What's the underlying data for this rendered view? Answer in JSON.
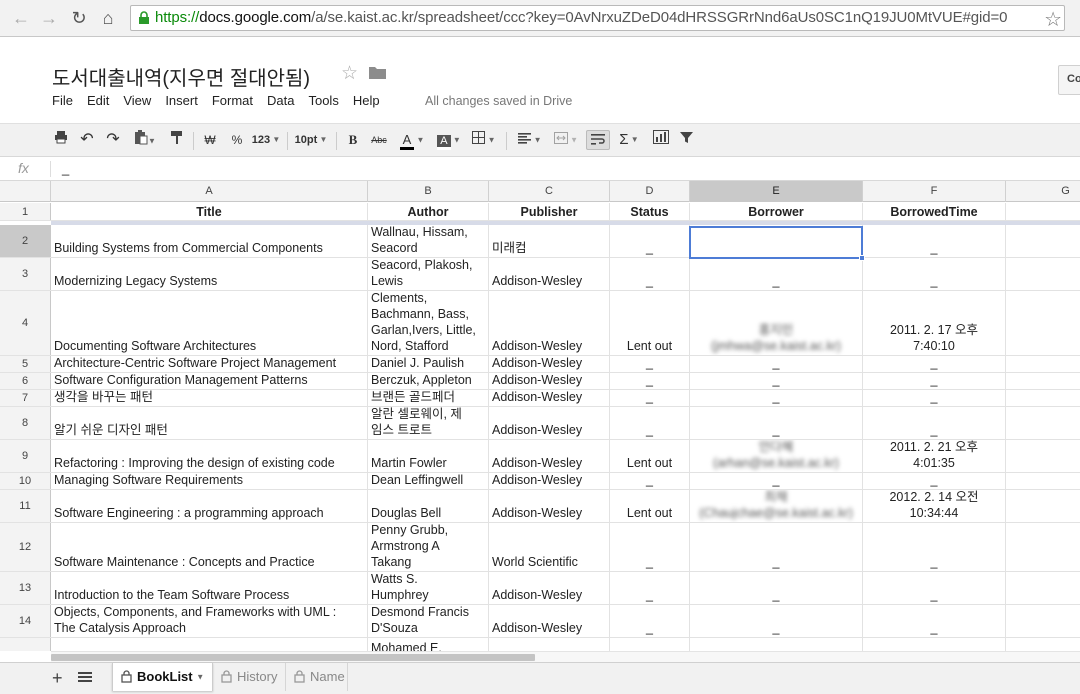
{
  "browser": {
    "url_scheme": "https://",
    "url_host": "docs.google.com",
    "url_path": "/a/se.kaist.ac.kr/spreadsheet/ccc?key=0AvNrxuZDeD04dHRSSGRrNnd6aUs0SC1nQ19JU0MtVUE#gid=0"
  },
  "doc": {
    "title": "도서대출내역(지우면 절대안됨)",
    "comment_label": "Co",
    "save_status": "All changes saved in Drive"
  },
  "menu": [
    "File",
    "Edit",
    "View",
    "Insert",
    "Format",
    "Data",
    "Tools",
    "Help"
  ],
  "toolbar": {
    "currency": "₩",
    "percent": "%",
    "number_format": "123",
    "font_size": "10pt",
    "bold": "B",
    "strike": "Abc",
    "text_color": "A",
    "fill_color": "A",
    "sum": "Σ"
  },
  "formula": {
    "fx": "fx",
    "value": "_"
  },
  "grid": {
    "columns": [
      "A",
      "B",
      "C",
      "D",
      "E",
      "F",
      "G"
    ],
    "headers": [
      "Title",
      "Author",
      "Publisher",
      "Status",
      "Borrower",
      "BorrowedTime"
    ],
    "rows": [
      {
        "num": "2",
        "title": "Building Systems from Commercial Components",
        "author": "Wallnau, Hissam,\nSeacord",
        "publisher": "미래컴",
        "status": "_",
        "borrower": "",
        "time": "_"
      },
      {
        "num": "3",
        "title": "Modernizing Legacy Systems",
        "author": "Seacord, Plakosh,\nLewis",
        "publisher": "Addison-Wesley",
        "status": "_",
        "borrower": "_",
        "time": "_"
      },
      {
        "num": "4",
        "title": "Documenting Software Architectures",
        "author": "Clements,\nBachmann, Bass,\nGarlan,Ivers, Little,\nNord, Stafford",
        "publisher": "Addison-Wesley",
        "status": "Lent out",
        "borrower": "홍지민\n(jmhwa@se.kaist.ac.kr)",
        "time": "2011. 2. 17 오후\n7:40:10"
      },
      {
        "num": "5",
        "title": "Architecture-Centric Software Project Management",
        "author": "Daniel J. Paulish",
        "publisher": "Addison-Wesley",
        "status": "_",
        "borrower": "_",
        "time": "_"
      },
      {
        "num": "6",
        "title": "Software Configuration Management Patterns",
        "author": "Berczuk, Appleton",
        "publisher": "Addison-Wesley",
        "status": "_",
        "borrower": "_",
        "time": "_"
      },
      {
        "num": "7",
        "title": "생각을 바꾸는 패턴",
        "author": "브랜든 골드페더",
        "publisher": "Addison-Wesley",
        "status": "_",
        "borrower": "_",
        "time": "_"
      },
      {
        "num": "8",
        "title": "알기 쉬운 디자인 패턴",
        "author": "알란 셀로웨이, 제\n임스 트로트",
        "publisher": "Addison-Wesley",
        "status": "_",
        "borrower": "_",
        "time": "_"
      },
      {
        "num": "9",
        "title": "Refactoring : Improving the design of existing code",
        "author": "Martin Fowler",
        "publisher": "Addison-Wesley",
        "status": "Lent out",
        "borrower": "안다혜\n(arhan@se.kaist.ac.kr)",
        "time": "2011. 2. 21 오후\n4:01:35"
      },
      {
        "num": "10",
        "title": "Managing Software Requirements",
        "author": "Dean Leffingwell",
        "publisher": "Addison-Wesley",
        "status": "_",
        "borrower": "_",
        "time": "_"
      },
      {
        "num": "11",
        "title": "Software Engineering : a programming approach",
        "author": "Douglas Bell",
        "publisher": "Addison-Wesley",
        "status": "Lent out",
        "borrower": "최채\n(Chaujchae@se.kaist.ac.kr)",
        "time": "2012. 2. 14 오전\n10:34:44"
      },
      {
        "num": "12",
        "title": "Software Maintenance : Concepts and Practice",
        "author": "Penny Grubb,\nArmstrong A\nTakang",
        "publisher": "World Scientific",
        "status": "_",
        "borrower": "_",
        "time": "_"
      },
      {
        "num": "13",
        "title": "Introduction to the Team Software Process",
        "author": "Watts S.\nHumphrey",
        "publisher": "Addison-Wesley",
        "status": "_",
        "borrower": "_",
        "time": "_"
      },
      {
        "num": "14",
        "title": "Objects, Components, and Frameworks with UML :\nThe Catalysis Approach",
        "author": "Desmond Francis\nD'Souza",
        "publisher": "Addison-Wesley",
        "status": "_",
        "borrower": "_",
        "time": "_"
      },
      {
        "num": "",
        "title": "",
        "author": "Mohamed E.",
        "publisher": "",
        "status": "",
        "borrower": "",
        "time": ""
      }
    ]
  },
  "sheets": {
    "add": "+",
    "tabs": [
      "BookList",
      "History",
      "Name"
    ]
  },
  "colors": {
    "selection": "#4d7cd6",
    "secure_green": "#0a8a0a"
  }
}
